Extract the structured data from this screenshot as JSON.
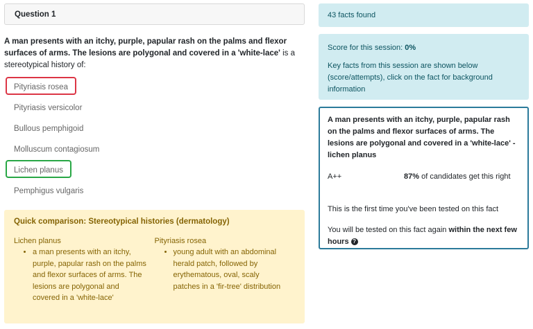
{
  "question": {
    "header": "Question 1",
    "stem_bold": "A man presents with an itchy, purple, papular rash on the palms and flexor surfaces of arms. The lesions are polygonal and covered in a 'white-lace'",
    "stem_rest": " is a stereotypical history of:",
    "options": [
      {
        "label": "Pityriasis rosea",
        "state": "wrong"
      },
      {
        "label": "Pityriasis versicolor",
        "state": "none"
      },
      {
        "label": "Bullous pemphigoid",
        "state": "none"
      },
      {
        "label": "Molluscum contagiosum",
        "state": "none"
      },
      {
        "label": "Lichen planus",
        "state": "correct"
      },
      {
        "label": "Pemphigus vulgaris",
        "state": "none"
      }
    ]
  },
  "comparison": {
    "title": "Quick comparison: Stereotypical histories (dermatology)",
    "columns": [
      {
        "title": "Lichen planus",
        "items": [
          "a man presents with an itchy, purple, papular rash on the palms and flexor surfaces of arms. The lesions are polygonal and covered in a 'white-lace'"
        ]
      },
      {
        "title": "Pityriasis rosea",
        "items": [
          "young adult with an abdominal herald patch, followed by erythematous, oval, scaly patches in a 'fir-tree' distribution"
        ]
      }
    ]
  },
  "sidebar": {
    "facts_found": "43 facts found",
    "score_label": "Score for this session: ",
    "score_value": "0%",
    "key_facts_text": "Key facts from this session are shown below (score/attempts), click on the fact for background information",
    "fact": {
      "title": "A man presents with an itchy, purple, papular rash on the palms and flexor surfaces of arms. The lesions are polygonal and covered in a 'white-lace' - lichen planus",
      "grade": "A++",
      "percent": "87%",
      "percent_suffix": " of candidates get this right",
      "first_time": "This is the first time you've been tested on this fact",
      "retest_prefix": "You will be tested on this fact again ",
      "retest_bold": "within the next few hours"
    }
  },
  "colors": {
    "wrong": "#dc3545",
    "correct": "#28a745",
    "info_bg": "#d1ecf1",
    "compare_bg": "#fff3cd"
  }
}
